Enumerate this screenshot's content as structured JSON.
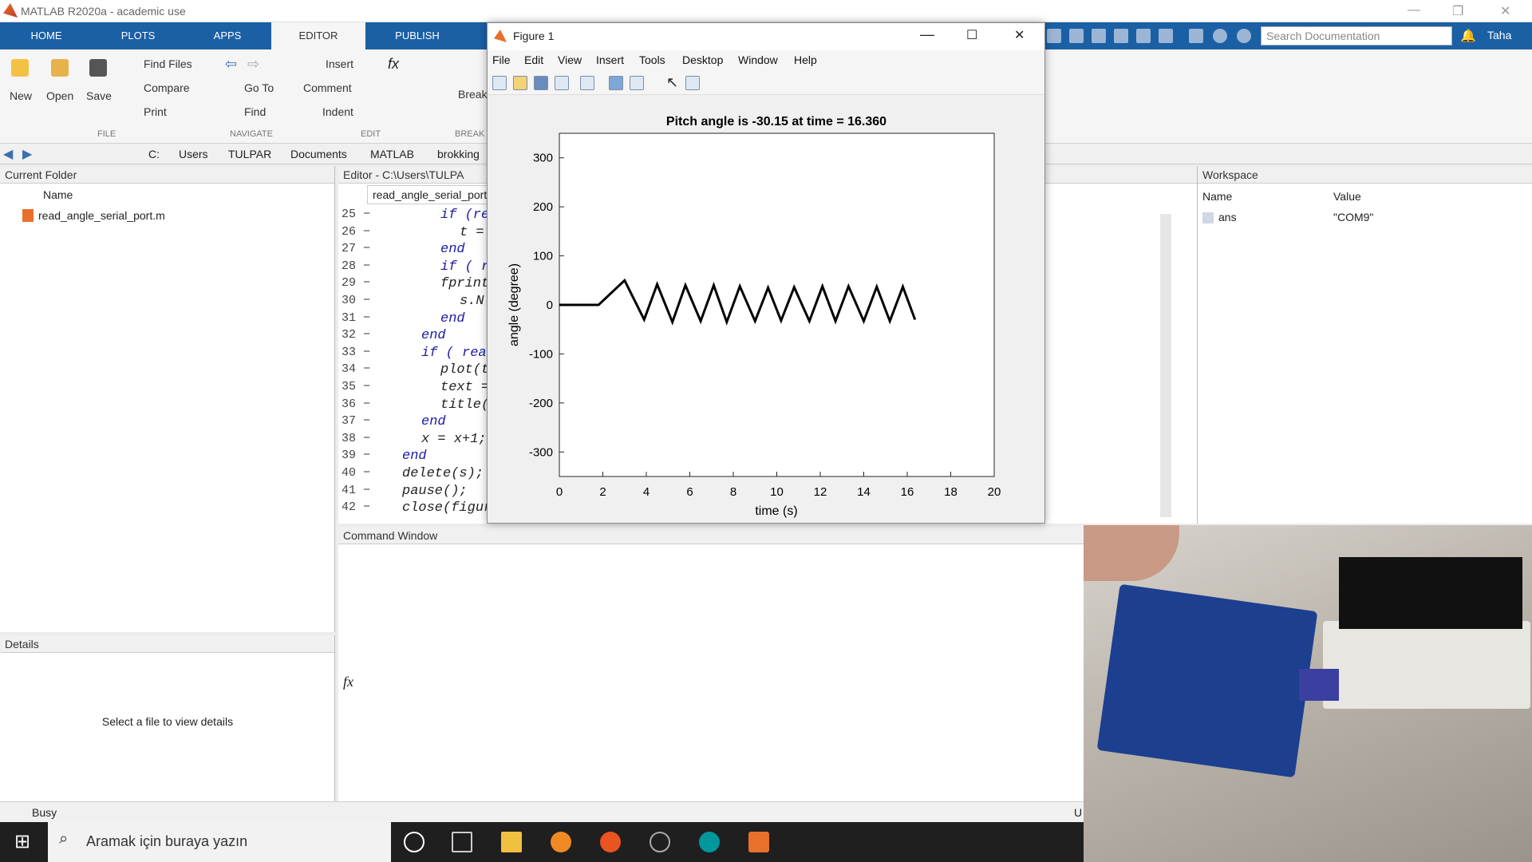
{
  "app": {
    "title": "MATLAB R2020a - academic use"
  },
  "ribbon": {
    "tabs": [
      "HOME",
      "PLOTS",
      "APPS",
      "EDITOR",
      "PUBLISH"
    ],
    "active_tab": "EDITOR",
    "search_placeholder": "Search Documentation",
    "user": "Taha",
    "file": {
      "new": "New",
      "open": "Open",
      "save": "Save",
      "find_files": "Find Files",
      "compare": "Compare",
      "print": "Print",
      "group": "FILE"
    },
    "navigate": {
      "go_to": "Go To",
      "find": "Find",
      "group": "NAVIGATE"
    },
    "edit": {
      "insert": "Insert",
      "comment": "Comment",
      "indent": "Indent",
      "group": "EDIT"
    },
    "breakpoints": {
      "label": "Break",
      "group": "BREAK"
    }
  },
  "address": {
    "crumbs": [
      "C:",
      "Users",
      "TULPAR",
      "Documents",
      "MATLAB",
      "brokking"
    ]
  },
  "current_folder": {
    "title": "Current Folder",
    "column": "Name",
    "files": [
      "read_angle_serial_port.m"
    ]
  },
  "details": {
    "title": "Details",
    "placeholder": "Select a file to view details"
  },
  "editor": {
    "title": "Editor - C:\\Users\\TULPA",
    "tab": "read_angle_serial_port",
    "lines": [
      {
        "num": "25",
        "code": "if (rea",
        "indent": 2,
        "kw": true
      },
      {
        "num": "26",
        "code": "t =",
        "indent": 3,
        "kw": false
      },
      {
        "num": "27",
        "code": "end",
        "indent": 2,
        "kw": true
      },
      {
        "num": "28",
        "code": "if ( rea",
        "indent": 2,
        "kw": true
      },
      {
        "num": "29",
        "code": "fprintf",
        "indent": 2,
        "kw": false
      },
      {
        "num": "30",
        "code": "s.N",
        "indent": 3,
        "kw": false
      },
      {
        "num": "31",
        "code": "end",
        "indent": 2,
        "kw": true
      },
      {
        "num": "32",
        "code": "end",
        "indent": 1,
        "kw": true
      },
      {
        "num": "33",
        "code": "if ( realTi",
        "indent": 1,
        "kw": true
      },
      {
        "num": "34",
        "code": "plot(t,",
        "indent": 2,
        "kw": false
      },
      {
        "num": "35",
        "code": "text =",
        "indent": 2,
        "kw": false
      },
      {
        "num": "36",
        "code": "title(te",
        "indent": 2,
        "kw": false
      },
      {
        "num": "37",
        "code": "end",
        "indent": 1,
        "kw": true
      },
      {
        "num": "38",
        "code": "x = x+1;",
        "indent": 1,
        "kw": false
      },
      {
        "num": "39",
        "code": "end",
        "indent": 0,
        "kw": true
      },
      {
        "num": "40",
        "code": "delete(s);",
        "indent": 0,
        "kw": false
      },
      {
        "num": "41",
        "code": "pause();",
        "indent": 0,
        "kw": false
      },
      {
        "num": "42",
        "code": "close(figure",
        "indent": 0,
        "kw": false
      }
    ]
  },
  "command_window": {
    "title": "Command Window",
    "prompt": "fx"
  },
  "workspace": {
    "title": "Workspace",
    "columns": [
      "Name",
      "Value"
    ],
    "rows": [
      {
        "name": "ans",
        "value": "\"COM9\""
      }
    ]
  },
  "status": {
    "text": "Busy",
    "right": "U"
  },
  "taskbar": {
    "search_placeholder": "Aramak için buraya yazın"
  },
  "figure": {
    "title": "Figure 1",
    "menu": [
      "File",
      "Edit",
      "View",
      "Insert",
      "Tools",
      "Desktop",
      "Window",
      "Help"
    ]
  },
  "chart_data": {
    "type": "line",
    "title": "Pitch angle is -30.15 at time = 16.360",
    "xlabel": "time (s)",
    "ylabel": "angle (degree)",
    "xlim": [
      0,
      20
    ],
    "ylim": [
      -350,
      350
    ],
    "xticks": [
      0,
      2,
      4,
      6,
      8,
      10,
      12,
      14,
      16,
      18,
      20
    ],
    "yticks": [
      -300,
      -200,
      -100,
      0,
      100,
      200,
      300
    ],
    "grid": false,
    "series": [
      {
        "x": [
          0,
          1.8,
          3.0,
          3.9,
          4.5,
          5.2,
          5.8,
          6.5,
          7.1,
          7.7,
          8.3,
          9.0,
          9.6,
          10.2,
          10.8,
          11.5,
          12.1,
          12.7,
          13.3,
          14.0,
          14.6,
          15.2,
          15.8,
          16.36
        ],
        "y": [
          0,
          0,
          50,
          -30,
          42,
          -35,
          40,
          -33,
          40,
          -35,
          38,
          -33,
          35,
          -32,
          36,
          -33,
          38,
          -33,
          38,
          -33,
          37,
          -33,
          37,
          -30.15
        ]
      }
    ]
  }
}
